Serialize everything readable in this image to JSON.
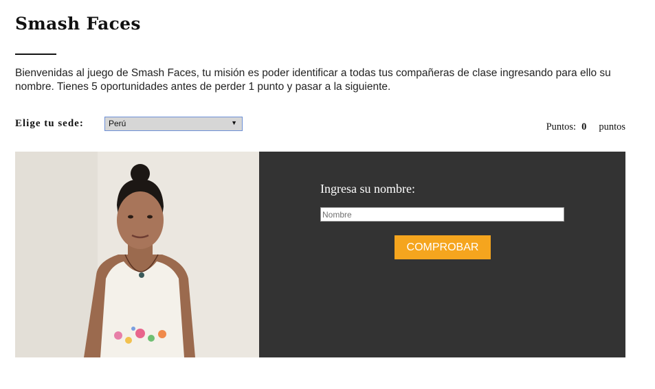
{
  "header": {
    "title": "Smash Faces",
    "intro": "Bienvenidas al juego de Smash Faces, tu misión es poder identificar a todas tus compañeras de clase ingresando para ello su nombre. Tienes 5 oportunidades antes de perder 1 punto y pasar a la siguiente."
  },
  "sede": {
    "label": "Elige tu sede:",
    "selected": "Perú"
  },
  "score": {
    "label": "Puntos:",
    "value": "0",
    "unit": "puntos"
  },
  "game": {
    "prompt": "Ingresa su nombre:",
    "input_placeholder": "Nombre",
    "input_value": "",
    "button_label": "COMPROBAR"
  },
  "colors": {
    "panel_bg": "#333333",
    "button_bg": "#f5a51e",
    "select_border": "#6c8fd6"
  }
}
